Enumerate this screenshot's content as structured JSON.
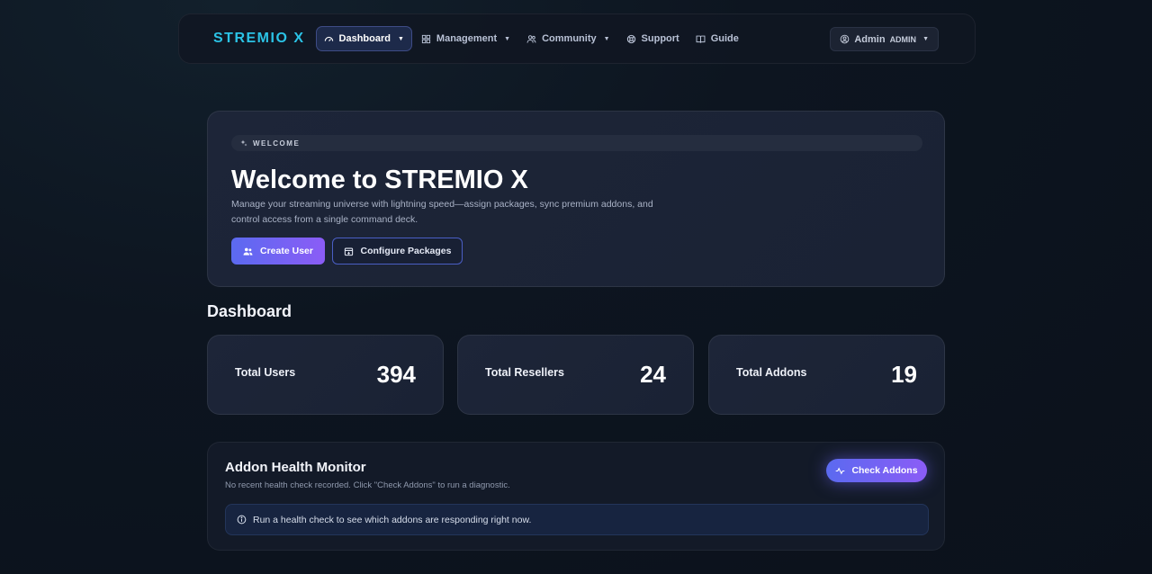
{
  "nav": {
    "brand": "STREMIO X",
    "items": [
      {
        "label": "Dashboard",
        "icon": "gauge-icon",
        "dropdown": true,
        "active": true
      },
      {
        "label": "Management",
        "icon": "grid-icon",
        "dropdown": true
      },
      {
        "label": "Community",
        "icon": "users-icon",
        "dropdown": true
      },
      {
        "label": "Support",
        "icon": "lifebuoy-icon",
        "dropdown": false
      },
      {
        "label": "Guide",
        "icon": "book-icon",
        "dropdown": false
      }
    ],
    "user": {
      "name": "Admin",
      "role": "ADMIN",
      "icon": "user-circle-icon"
    }
  },
  "hero": {
    "badge": "WELCOME",
    "title": "Welcome to STREMIO X",
    "description": "Manage your streaming universe with lightning speed—assign packages, sync premium addons, and control access from a single command deck.",
    "primary_button": "Create User",
    "secondary_button": "Configure Packages"
  },
  "dashboard": {
    "title": "Dashboard",
    "stats": [
      {
        "label": "Total Users",
        "value": "394"
      },
      {
        "label": "Total Resellers",
        "value": "24"
      },
      {
        "label": "Total Addons",
        "value": "19"
      }
    ]
  },
  "monitor": {
    "title": "Addon Health Monitor",
    "subtitle": "No recent health check recorded. Click \"Check Addons\" to run a diagnostic.",
    "button": "Check Addons",
    "alert": "Run a health check to see which addons are responding right now."
  },
  "colors": {
    "accent": "#2bc3e6",
    "primary_gradient_start": "#5b6af0",
    "primary_gradient_end": "#8b5cf6"
  }
}
